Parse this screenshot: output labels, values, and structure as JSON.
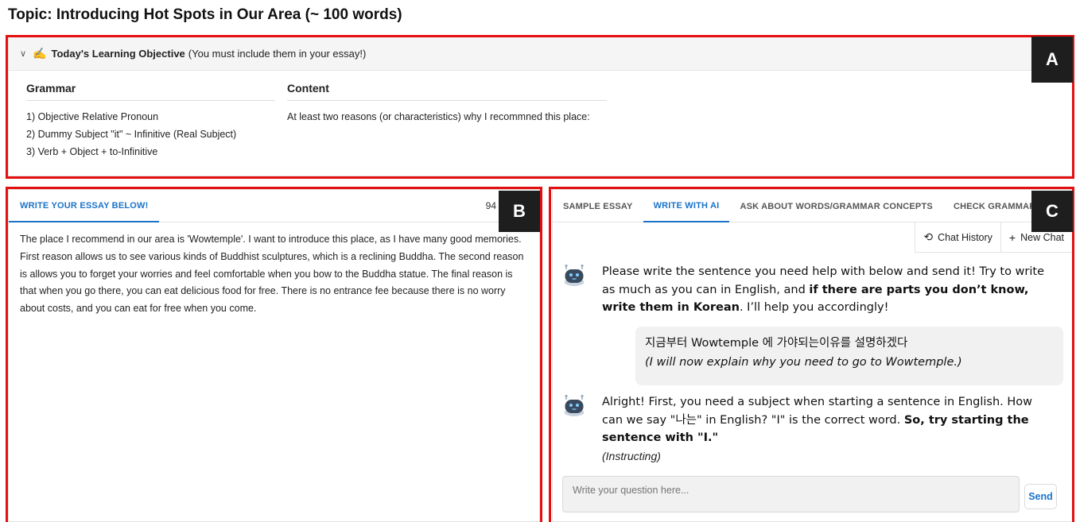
{
  "page": {
    "title": "Topic: Introducing Hot Spots in Our Area (~ 100 words)"
  },
  "objective": {
    "heading": "Today's Learning Objective",
    "note": "(You must include them in your essay!)",
    "grammar_heading": "Grammar",
    "grammar_items": [
      "1) Objective Relative Pronoun",
      "2) Dummy Subject \"it\" ~ Infinitive (Real Subject)",
      "3) Verb + Object + to-Infinitive"
    ],
    "content_heading": "Content",
    "content_items": [
      "At least two reasons (or characteristics) why I recommned this place:"
    ]
  },
  "essay": {
    "tab_label": "WRITE YOUR ESSAY BELOW!",
    "word_count": "94",
    "text": "The place I recommend in our area is 'Wowtemple'. I want to introduce this place, as I have many good memories. First reason allows us to see various kinds of Buddhist sculptures, which is a reclining Buddha. The second reason is allows you to forget your worries and feel comfortable when you bow to the Buddha statue. The final reason is that when you go there, you can eat delicious food for free. There is no entrance fee because there is no worry about costs, and you can eat for free when you come."
  },
  "chat": {
    "tabs": [
      "SAMPLE ESSAY",
      "WRITE WITH AI",
      "ASK ABOUT WORDS/GRAMMAR CONCEPTS",
      "CHECK GRAMMAR"
    ],
    "active_tab": "WRITE WITH AI",
    "history_label": "Chat History",
    "new_chat_label": "New Chat",
    "bot_msg_1": {
      "part1": "Please write the sentence you need help with below and send it! Try to write as much as you can in English, and ",
      "bold": "if there are parts you don’t know, write them in Korean",
      "part2": ". I’ll help you accordingly!"
    },
    "user_msg": {
      "text": "지금부터 Wowtemple 에 가야되는이유를 설명하겠다",
      "translation": "(I will now explain why you need to go to Wowtemple.)"
    },
    "bot_msg_2": {
      "part1": "Alright! First, you need a subject when starting a sentence in English. How can we say \"나는\" in English? \"I\" is the correct word. ",
      "bold": "So, try starting the sentence with \"I.\"",
      "annotation": "(Instructing)"
    },
    "input_placeholder": "Write your question here...",
    "send_label": "Send"
  },
  "annotations": {
    "a": "A",
    "b": "B",
    "c": "C"
  },
  "colors": {
    "accent": "#1a73c8",
    "annotation_red": "#e41010",
    "label_bg": "#1e1e1e"
  }
}
